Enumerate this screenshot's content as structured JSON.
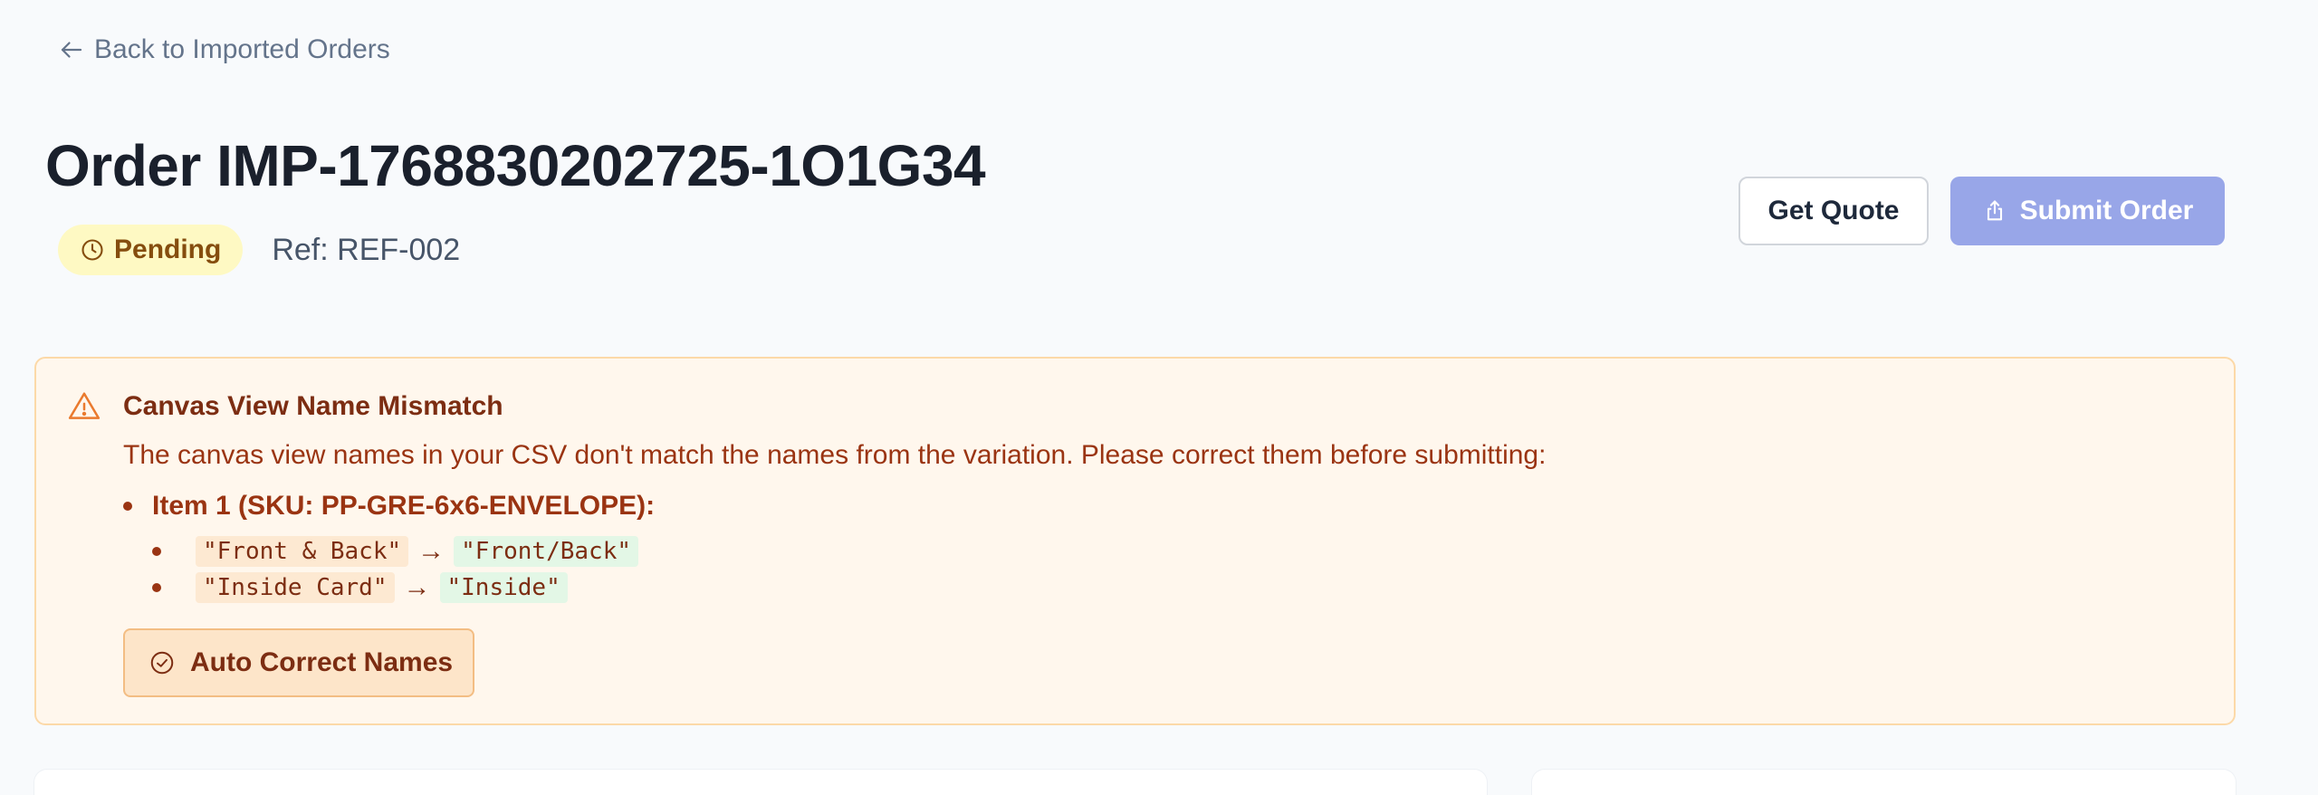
{
  "nav": {
    "back_label": "Back to Imported Orders"
  },
  "order": {
    "title": "Order IMP-1768830202725-1O1G34",
    "status": "Pending",
    "ref": "Ref: REF-002"
  },
  "actions": {
    "quote_label": "Get Quote",
    "submit_label": "Submit Order"
  },
  "alert": {
    "title": "Canvas View Name Mismatch",
    "description": "The canvas view names in your CSV don't match the names from the variation. Please correct them before submitting:",
    "items": [
      {
        "label": "Item 1 (SKU: PP-GRE-6x6-ENVELOPE):",
        "corrections": [
          {
            "from": "\"Front & Back\"",
            "to": "\"Front/Back\""
          },
          {
            "from": "\"Inside Card\"",
            "to": "\"Inside\""
          }
        ]
      }
    ],
    "auto_correct_label": "Auto Correct Names"
  },
  "colors": {
    "page_bg": "#f8fafc",
    "status_bg": "#fef9c3",
    "status_text": "#854d0e",
    "submit_bg": "#98a6e8",
    "alert_bg": "#fff7ed",
    "alert_border": "#fcd9a8",
    "alert_text": "#9a3412"
  },
  "icons": {
    "back": "arrow-left-icon",
    "status": "clock-icon",
    "submit": "share-upload-icon",
    "alert": "warning-triangle-icon",
    "auto_correct": "check-circle-icon"
  }
}
